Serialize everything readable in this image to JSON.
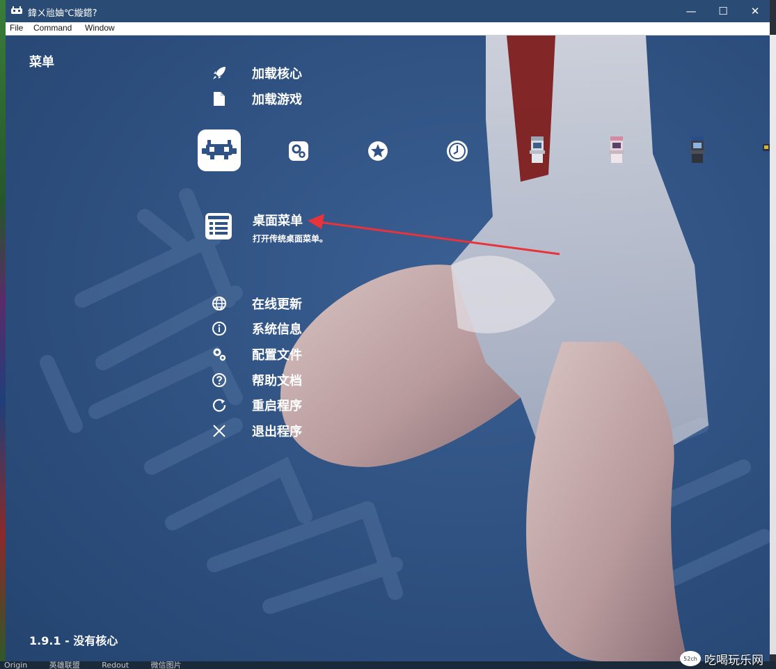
{
  "window": {
    "title": "鍏ㄨ兘妯℃嫙鍣?",
    "minimize_glyph": "—",
    "maximize_glyph": "☐",
    "close_glyph": "✕"
  },
  "menubar": {
    "file": "File",
    "command": "Command",
    "window": "Window"
  },
  "menu": {
    "title": "菜单",
    "top_items": [
      {
        "label": "加载核心",
        "icon": "rocket-icon"
      },
      {
        "label": "加载游戏",
        "icon": "file-icon"
      }
    ],
    "tabs": [
      {
        "name": "retroarch-main-tab",
        "icon": "invader-icon",
        "selected": true
      },
      {
        "name": "settings-tab",
        "icon": "gear-icon"
      },
      {
        "name": "favorites-tab",
        "icon": "star-icon"
      },
      {
        "name": "history-tab",
        "icon": "clock-icon"
      },
      {
        "name": "arcade-playlist-tab-1",
        "icon": "arcade-cabinet-icon"
      },
      {
        "name": "arcade-playlist-tab-2",
        "icon": "arcade-cabinet-icon"
      },
      {
        "name": "arcade-playlist-tab-3",
        "icon": "arcade-cabinet-icon"
      }
    ],
    "featured": {
      "title": "桌面菜单",
      "subtitle": "打开传统桌面菜单。",
      "icon": "list-icon"
    },
    "bottom_items": [
      {
        "label": "在线更新",
        "icon": "globe-icon"
      },
      {
        "label": "系统信息",
        "icon": "info-icon"
      },
      {
        "label": "配置文件",
        "icon": "gear-icon"
      },
      {
        "label": "帮助文档",
        "icon": "help-icon"
      },
      {
        "label": "重启程序",
        "icon": "restart-icon"
      },
      {
        "label": "退出程序",
        "icon": "close-icon"
      }
    ]
  },
  "status": {
    "version": "1.9.1 - 没有核心"
  },
  "taskbar": {
    "items": [
      "Origin",
      "英雄联盟",
      "Redout",
      "微信图片"
    ]
  },
  "watermark": {
    "text": "吃喝玩乐网",
    "badge": "52ch"
  },
  "colors": {
    "titlebar": "#2a4b73",
    "content_bg": "#2f5387",
    "annotation_arrow": "#e8333a"
  }
}
